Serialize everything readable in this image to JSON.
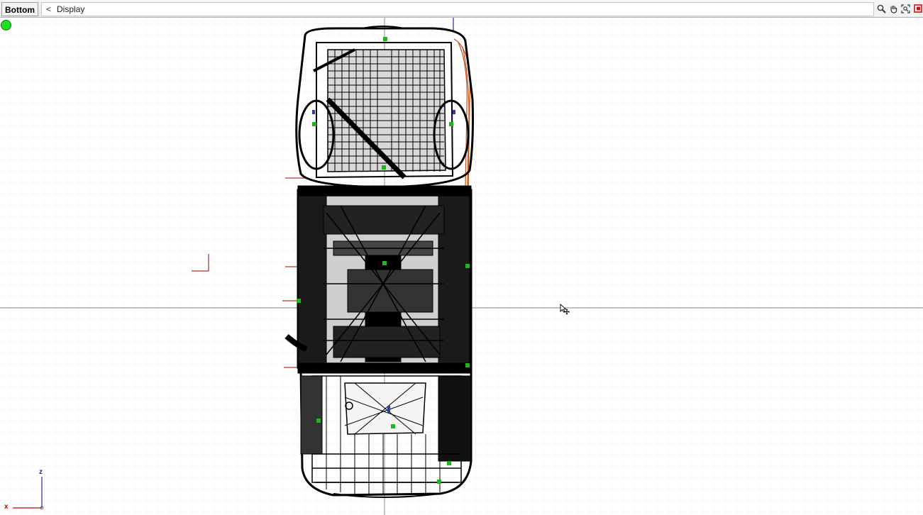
{
  "viewport": {
    "view_name": "Bottom",
    "menu_chevron": "<",
    "menu_label": "Display"
  },
  "toolbar_icons": [
    "zoom-icon",
    "pan-hand-icon",
    "zoom-extents-icon",
    "maximize-viewport-icon"
  ],
  "axis_gizmo": {
    "vertical_label": "z",
    "horizontal_label": "x"
  },
  "colors": {
    "grid": "#e6e6e6",
    "world_axis": "#8c8c8c",
    "wireframe": "#000000",
    "accent_orange": "#c0501a",
    "vertex_green": "#1fb51f",
    "status_green": "#22dd22",
    "gizmo_x": "#c00000",
    "gizmo_z": "#1a2a9a"
  },
  "status_indicator": "green-status-dot"
}
